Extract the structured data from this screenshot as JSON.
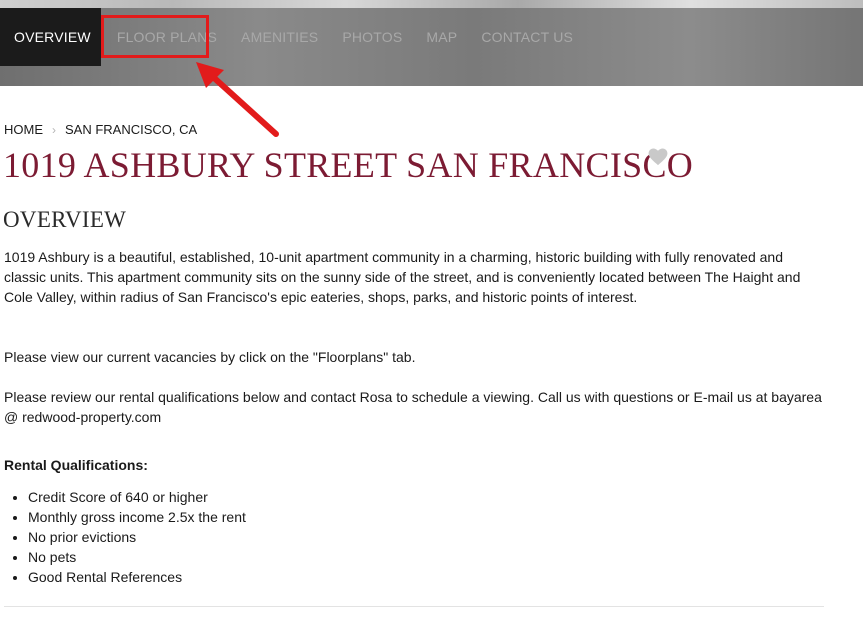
{
  "nav": {
    "items": [
      {
        "label": "OVERVIEW"
      },
      {
        "label": "FLOOR PLANS"
      },
      {
        "label": "AMENITIES"
      },
      {
        "label": "PHOTOS"
      },
      {
        "label": "MAP"
      },
      {
        "label": "CONTACT US"
      }
    ],
    "active_index": 0
  },
  "breadcrumb": {
    "home": "HOME",
    "current": "SAN FRANCISCO, CA"
  },
  "page_title": "1019 ASHBURY STREET SAN FRANCISCO",
  "overview": {
    "heading": "OVERVIEW",
    "paragraph1": "1019 Ashbury is a beautiful, established, 10-unit apartment community in a charming, historic building with fully renovated and classic units. This apartment community sits on the sunny side of the street, and is conveniently located between The Haight and Cole Valley, within radius of San Francisco's epic eateries, shops, parks, and historic points of interest.",
    "paragraph2": "Please view our current vacancies by click on the \"Floorplans\" tab.",
    "paragraph3": "Please review our rental qualifications below and contact Rosa to schedule a viewing. Call us with questions or E-mail us at bayarea @ redwood-property.com"
  },
  "qualifications": {
    "heading": "Rental Qualifications:",
    "items": [
      "Credit Score of 640 or higher",
      "Monthly gross income 2.5x the rent",
      "No prior evictions",
      "No pets",
      "Good Rental References"
    ]
  },
  "colors": {
    "title": "#7c1b33",
    "nav_active_bg": "#1b1b1b",
    "highlight": "#e21b1b"
  },
  "icons": {
    "favorite": "heart-icon",
    "breadcrumb_separator": "chevron-right-icon"
  }
}
